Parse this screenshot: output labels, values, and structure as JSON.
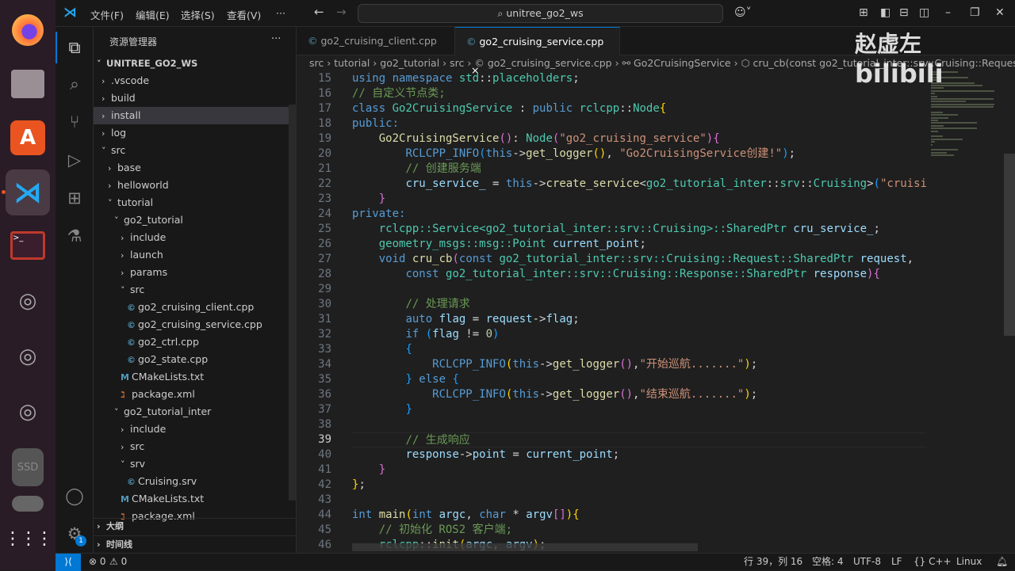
{
  "dock": {
    "items": [
      "firefox",
      "files",
      "app-center",
      "vscode",
      "terminal",
      "disk",
      "disk",
      "disk",
      "ssd",
      "disk",
      "app-grid"
    ],
    "ssd_label": "SSD"
  },
  "titlebar": {
    "menus": [
      "文件(F)",
      "编辑(E)",
      "选择(S)",
      "查看(V)",
      "···"
    ],
    "search": "unitree_go2_ws"
  },
  "sidebar": {
    "title": "资源管理器",
    "more": "···",
    "root": "UNITREE_GO2_WS",
    "items": [
      {
        "label": ".vscode",
        "level": 1,
        "chev": "closed"
      },
      {
        "label": "build",
        "level": 1,
        "chev": "closed"
      },
      {
        "label": "install",
        "level": 1,
        "chev": "closed",
        "selected": true
      },
      {
        "label": "log",
        "level": 1,
        "chev": "closed"
      },
      {
        "label": "src",
        "level": 1,
        "chev": "open"
      },
      {
        "label": "base",
        "level": 2,
        "chev": "closed"
      },
      {
        "label": "helloworld",
        "level": 2,
        "chev": "closed"
      },
      {
        "label": "tutorial",
        "level": 2,
        "chev": "open"
      },
      {
        "label": "go2_tutorial",
        "level": 3,
        "chev": "open"
      },
      {
        "label": "include",
        "level": 4,
        "chev": "closed"
      },
      {
        "label": "launch",
        "level": 4,
        "chev": "closed"
      },
      {
        "label": "params",
        "level": 4,
        "chev": "closed"
      },
      {
        "label": "src",
        "level": 4,
        "chev": "open"
      },
      {
        "label": "go2_cruising_client.cpp",
        "level": 5,
        "icon": "cpp"
      },
      {
        "label": "go2_cruising_service.cpp",
        "level": 5,
        "icon": "cpp"
      },
      {
        "label": "go2_ctrl.cpp",
        "level": 5,
        "icon": "cpp"
      },
      {
        "label": "go2_state.cpp",
        "level": 5,
        "icon": "cpp"
      },
      {
        "label": "CMakeLists.txt",
        "level": 4,
        "icon": "cmake"
      },
      {
        "label": "package.xml",
        "level": 4,
        "icon": "xml"
      },
      {
        "label": "go2_tutorial_inter",
        "level": 3,
        "chev": "open"
      },
      {
        "label": "include",
        "level": 4,
        "chev": "closed"
      },
      {
        "label": "src",
        "level": 4,
        "chev": "closed"
      },
      {
        "label": "srv",
        "level": 4,
        "chev": "open"
      },
      {
        "label": "Cruising.srv",
        "level": 5,
        "icon": "srv"
      },
      {
        "label": "CMakeLists.txt",
        "level": 4,
        "icon": "cmake"
      },
      {
        "label": "package.xml",
        "level": 4,
        "icon": "xml"
      }
    ],
    "outline": "大纲",
    "timeline": "时间线",
    "settings_badge": "1"
  },
  "tabs": [
    {
      "label": "go2_cruising_client.cpp",
      "active": false
    },
    {
      "label": "go2_cruising_service.cpp",
      "active": true,
      "close": "×"
    }
  ],
  "breadcrumb": [
    "src",
    "tutorial",
    "go2_tutorial",
    "src",
    "go2_cruising_service.cpp",
    "Go2CruisingService",
    "cru_cb(const go2_tutorial_inter::srv::Cruising::Request:"
  ],
  "code": {
    "start": 15,
    "current": 39,
    "lines": [
      [
        [
          "kw",
          "using"
        ],
        [
          "kw",
          " namespace"
        ],
        [
          "ty",
          " std"
        ],
        [
          "pl",
          "::"
        ],
        [
          "ty",
          "placeholders"
        ],
        [
          "pl",
          ";"
        ]
      ],
      [
        [
          "cm",
          "// 自定义节点类;"
        ]
      ],
      [
        [
          "kw",
          "class"
        ],
        [
          "ty",
          " Go2CruisingService"
        ],
        [
          "pl",
          " : "
        ],
        [
          "kw",
          "public"
        ],
        [
          "ty",
          " rclcpp"
        ],
        [
          "pl",
          "::"
        ],
        [
          "ty",
          "Node"
        ],
        [
          "br",
          "{"
        ]
      ],
      [
        [
          "kw",
          "public:"
        ]
      ],
      [
        [
          "pl",
          "    "
        ],
        [
          "fn",
          "Go2CruisingService"
        ],
        [
          "br2",
          "()"
        ],
        [
          "pl",
          ": "
        ],
        [
          "ty",
          "Node"
        ],
        [
          "br2",
          "("
        ],
        [
          "str",
          "\"go2_cruising_service\""
        ],
        [
          "br2",
          ")"
        ],
        [
          "br2",
          "{"
        ]
      ],
      [
        [
          "pl",
          "        "
        ],
        [
          "kw",
          "RCLCPP_INFO"
        ],
        [
          "br3",
          "("
        ],
        [
          "kw",
          "this"
        ],
        [
          "pl",
          "->"
        ],
        [
          "fn",
          "get_logger"
        ],
        [
          "br",
          "()"
        ],
        [
          "pl",
          ", "
        ],
        [
          "str",
          "\"Go2CruisingService创建!\""
        ],
        [
          "br3",
          ")"
        ],
        [
          "pl",
          ";"
        ]
      ],
      [
        [
          "pl",
          "        "
        ],
        [
          "cm",
          "// 创建服务端"
        ]
      ],
      [
        [
          "pl",
          "        "
        ],
        [
          "var",
          "cru_service_"
        ],
        [
          "pl",
          " = "
        ],
        [
          "kw",
          "this"
        ],
        [
          "pl",
          "->"
        ],
        [
          "fn",
          "create_service"
        ],
        [
          "pl",
          "<"
        ],
        [
          "ty",
          "go2_tutorial_inter"
        ],
        [
          "pl",
          "::"
        ],
        [
          "ty",
          "srv"
        ],
        [
          "pl",
          "::"
        ],
        [
          "ty",
          "Cruising"
        ],
        [
          "pl",
          ">"
        ],
        [
          "br3",
          "("
        ],
        [
          "str",
          "\"cruisi"
        ]
      ],
      [
        [
          "pl",
          "    "
        ],
        [
          "br2",
          "}"
        ]
      ],
      [
        [
          "kw",
          "private:"
        ]
      ],
      [
        [
          "pl",
          "    "
        ],
        [
          "ty",
          "rclcpp::Service<go2_tutorial_inter::srv::Cruising>::SharedPtr"
        ],
        [
          "var",
          " cru_service_"
        ],
        [
          "pl",
          ";"
        ]
      ],
      [
        [
          "pl",
          "    "
        ],
        [
          "ty",
          "geometry_msgs::msg::Point"
        ],
        [
          "var",
          " current_point"
        ],
        [
          "pl",
          ";"
        ]
      ],
      [
        [
          "pl",
          "    "
        ],
        [
          "kw",
          "void"
        ],
        [
          "fn",
          " cru_cb"
        ],
        [
          "br2",
          "("
        ],
        [
          "kw",
          "const"
        ],
        [
          "ty",
          " go2_tutorial_inter::srv::Cruising::Request::SharedPtr"
        ],
        [
          "var",
          " request"
        ],
        [
          "pl",
          ","
        ]
      ],
      [
        [
          "pl",
          "        "
        ],
        [
          "kw",
          "const"
        ],
        [
          "ty",
          " go2_tutorial_inter::srv::Cruising::Response::SharedPtr"
        ],
        [
          "var",
          " response"
        ],
        [
          "br2",
          ")"
        ],
        [
          "br2",
          "{"
        ]
      ],
      [],
      [
        [
          "pl",
          "        "
        ],
        [
          "cm",
          "// 处理请求"
        ]
      ],
      [
        [
          "pl",
          "        "
        ],
        [
          "kw",
          "auto"
        ],
        [
          "var",
          " flag"
        ],
        [
          "pl",
          " = "
        ],
        [
          "var",
          "request"
        ],
        [
          "pl",
          "->"
        ],
        [
          "var",
          "flag"
        ],
        [
          "pl",
          ";"
        ]
      ],
      [
        [
          "pl",
          "        "
        ],
        [
          "kw",
          "if"
        ],
        [
          "br3",
          " ("
        ],
        [
          "var",
          "flag"
        ],
        [
          "pl",
          " != "
        ],
        [
          "num",
          "0"
        ],
        [
          "br3",
          ")"
        ]
      ],
      [
        [
          "pl",
          "        "
        ],
        [
          "br3",
          "{"
        ]
      ],
      [
        [
          "pl",
          "            "
        ],
        [
          "kw",
          "RCLCPP_INFO"
        ],
        [
          "br",
          "("
        ],
        [
          "kw",
          "this"
        ],
        [
          "pl",
          "->"
        ],
        [
          "fn",
          "get_logger"
        ],
        [
          "br2",
          "()"
        ],
        [
          "pl",
          ","
        ],
        [
          "str",
          "\"开始巡航.......\""
        ],
        [
          "br",
          ")"
        ],
        [
          "pl",
          ";"
        ]
      ],
      [
        [
          "pl",
          "        "
        ],
        [
          "br3",
          "}"
        ],
        [
          "kw",
          " else"
        ],
        [
          "br3",
          " {"
        ]
      ],
      [
        [
          "pl",
          "            "
        ],
        [
          "kw",
          "RCLCPP_INFO"
        ],
        [
          "br",
          "("
        ],
        [
          "kw",
          "this"
        ],
        [
          "pl",
          "->"
        ],
        [
          "fn",
          "get_logger"
        ],
        [
          "br2",
          "()"
        ],
        [
          "pl",
          ","
        ],
        [
          "str",
          "\"结束巡航.......\""
        ],
        [
          "br",
          ")"
        ],
        [
          "pl",
          ";"
        ]
      ],
      [
        [
          "pl",
          "        "
        ],
        [
          "br3",
          "}"
        ]
      ],
      [],
      [
        [
          "pl",
          "        "
        ],
        [
          "cm",
          "// 生成响应"
        ]
      ],
      [
        [
          "pl",
          "        "
        ],
        [
          "var",
          "response"
        ],
        [
          "pl",
          "->"
        ],
        [
          "var",
          "point"
        ],
        [
          "pl",
          " = "
        ],
        [
          "var",
          "current_point"
        ],
        [
          "pl",
          ";"
        ]
      ],
      [
        [
          "pl",
          "    "
        ],
        [
          "br2",
          "}"
        ]
      ],
      [
        [
          "br",
          "}"
        ],
        [
          "pl",
          ";"
        ]
      ],
      [],
      [
        [
          "kw",
          "int"
        ],
        [
          "fn",
          " main"
        ],
        [
          "br",
          "("
        ],
        [
          "kw",
          "int"
        ],
        [
          "var",
          " argc"
        ],
        [
          "pl",
          ", "
        ],
        [
          "kw",
          "char"
        ],
        [
          "pl",
          " * "
        ],
        [
          "var",
          "argv"
        ],
        [
          "br2",
          "[]"
        ],
        [
          "br",
          ")"
        ],
        [
          "br",
          "{"
        ]
      ],
      [
        [
          "pl",
          "    "
        ],
        [
          "cm",
          "// 初始化 ROS2 客户端;"
        ]
      ],
      [
        [
          "pl",
          "    "
        ],
        [
          "ty",
          "rclcpp"
        ],
        [
          "pl",
          "::"
        ],
        [
          "fn",
          "init"
        ],
        [
          "br",
          "("
        ],
        [
          "var",
          "argc"
        ],
        [
          "pl",
          ", "
        ],
        [
          "var",
          "argv"
        ],
        [
          "br",
          ")"
        ],
        [
          "pl",
          ";"
        ]
      ]
    ]
  },
  "statusbar": {
    "errors": "⊗ 0",
    "warnings": "⚠ 0",
    "position": "行 39，列 16",
    "spaces": "空格: 4",
    "encoding": "UTF-8",
    "eol": "LF",
    "language": "{} C++",
    "os": "Linux"
  },
  "watermark": "赵虚左 bilibili"
}
